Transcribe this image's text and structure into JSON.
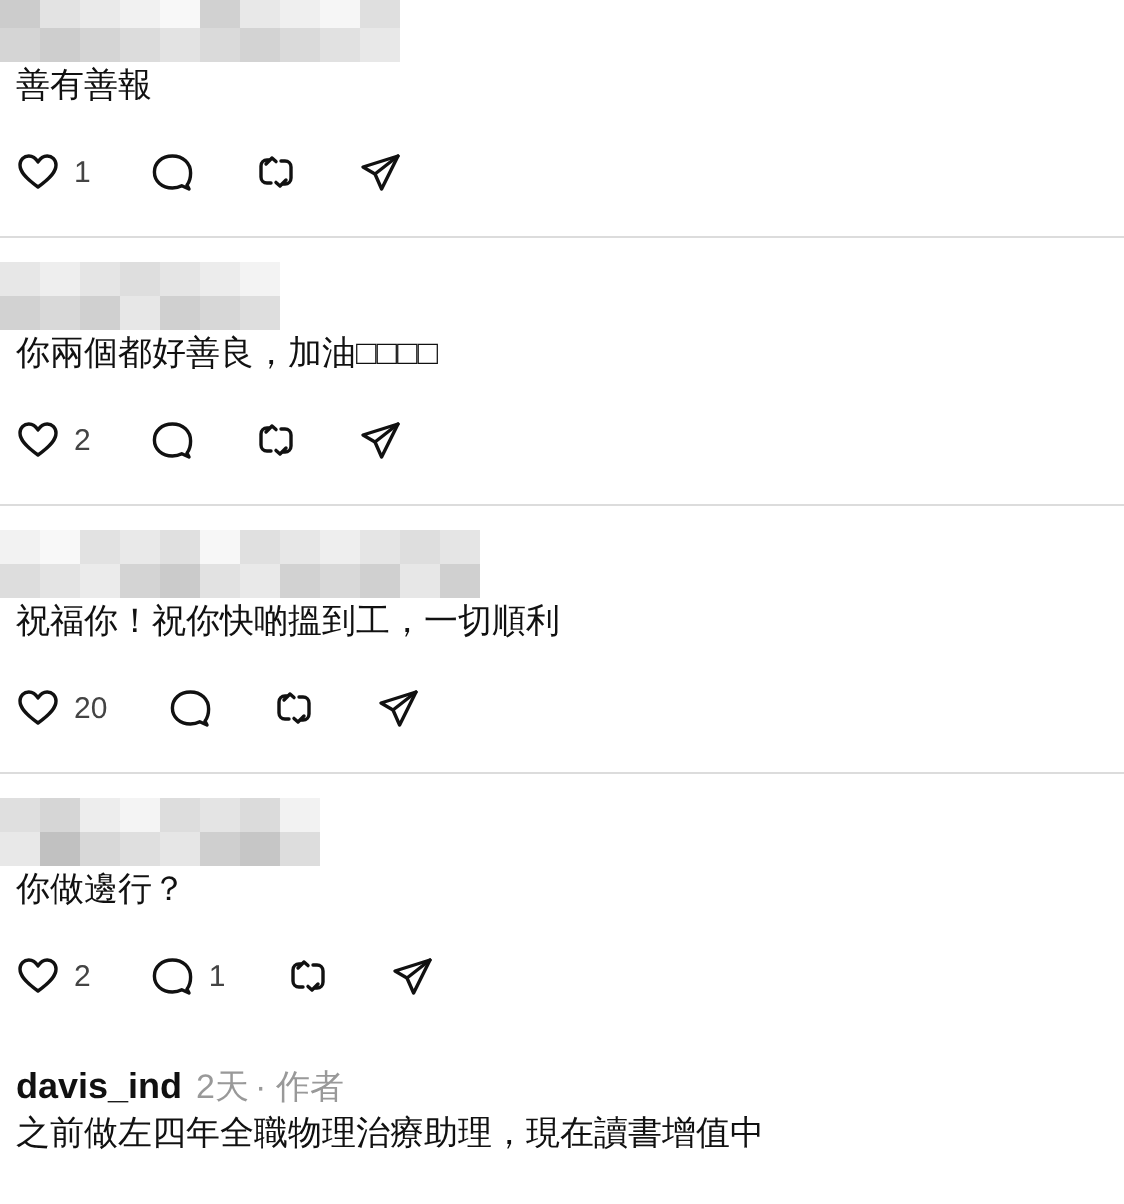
{
  "replies": [
    {
      "author": {
        "kind": "redacted"
      },
      "text": "善有善報",
      "actions": {
        "likes": "1"
      }
    },
    {
      "author": {
        "kind": "redacted"
      },
      "text": "你兩個都好善良，加油□□□□",
      "actions": {
        "likes": "2"
      }
    },
    {
      "author": {
        "kind": "redacted"
      },
      "text": "祝福你！祝你快啲搵到工，一切順利",
      "actions": {
        "likes": "20"
      }
    },
    {
      "author": {
        "kind": "redacted"
      },
      "text": "你做邊行？",
      "actions": {
        "likes": "2",
        "replies": "1"
      }
    },
    {
      "author": {
        "kind": "user",
        "username": "davis_ind",
        "time": "2天",
        "role": "· 作者"
      },
      "text": "之前做左四年全職物理治療助理，現在讀書增值中"
    }
  ]
}
